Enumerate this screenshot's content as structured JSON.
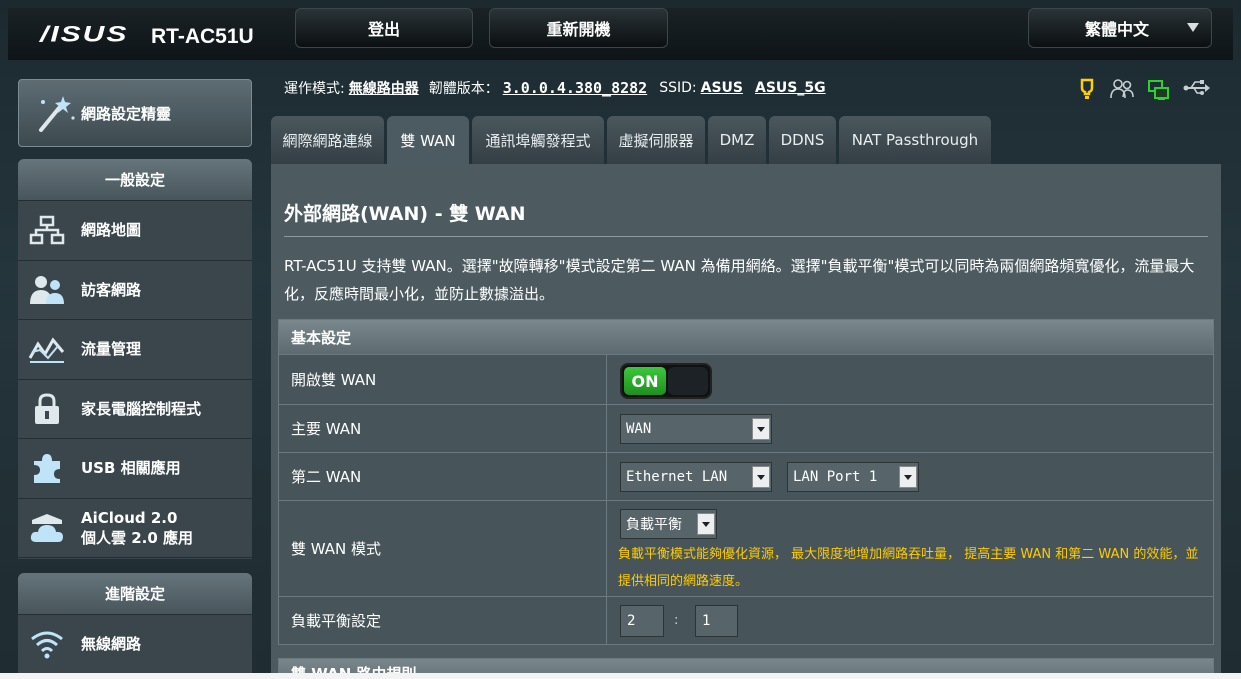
{
  "header": {
    "brand": "/ISUS",
    "model": "RT-AC51U",
    "logout_label": "登出",
    "reboot_label": "重新開機",
    "language": "繁體中文"
  },
  "sidebar": {
    "wizard_label": "網路設定精靈",
    "general_title": "一般設定",
    "general_items": [
      {
        "label": "網路地圖",
        "icon": "network-map-icon"
      },
      {
        "label": "訪客網路",
        "icon": "guest-network-icon"
      },
      {
        "label": "流量管理",
        "icon": "traffic-manager-icon"
      },
      {
        "label": "家長電腦控制程式",
        "icon": "lock-icon"
      },
      {
        "label": "USB 相關應用",
        "icon": "puzzle-icon"
      },
      {
        "label": "AiCloud 2.0",
        "label2": "個人雲 2.0 應用",
        "icon": "cloud-icon"
      }
    ],
    "advanced_title": "進階設定",
    "advanced_items": [
      {
        "label": "無線網路",
        "icon": "wifi-icon"
      }
    ]
  },
  "status": {
    "mode_label": "運作模式:",
    "mode_value": "無線路由器",
    "firmware_label": "韌體版本：",
    "firmware_value": "3.0.0.4.380_8282",
    "ssid_label": "SSID:",
    "ssid_1": "ASUS",
    "ssid_2": "ASUS_5G",
    "icons": [
      "notification-bulb-icon",
      "clients-icon",
      "network-status-icon",
      "usb-icon"
    ],
    "colors": {
      "bulb": "#ffd000",
      "network": "#2bd42b"
    }
  },
  "tabs": [
    {
      "label": "網際網路連線",
      "active": false
    },
    {
      "label": "雙 WAN",
      "active": true
    },
    {
      "label": "通訊埠觸發程式",
      "active": false
    },
    {
      "label": "虛擬伺服器",
      "active": false
    },
    {
      "label": "DMZ",
      "active": false
    },
    {
      "label": "DDNS",
      "active": false
    },
    {
      "label": "NAT Passthrough",
      "active": false
    }
  ],
  "main": {
    "title": "外部網路(WAN) - 雙 WAN",
    "description": "RT-AC51U 支持雙 WAN。選擇\"故障轉移\"模式設定第二 WAN 為備用網絡。選擇\"負載平衡\"模式可以同時為兩個網路頻寬優化，流量最大化，反應時間最小化，並防止數據溢出。",
    "section_title": "基本設定",
    "rows": {
      "enable_label": "開啟雙 WAN",
      "enable_state": "ON",
      "primary_label": "主要 WAN",
      "primary_value": "WAN",
      "second_label": "第二 WAN",
      "second_value": "Ethernet LAN",
      "second_port": "LAN Port 1",
      "mode_label": "雙 WAN 模式",
      "mode_value": "負載平衡",
      "mode_note": "負載平衡模式能夠優化資源， 最大限度地增加網路吞吐量， 提高主要 WAN 和第二 WAN 的效能，並提供相同的網路速度。",
      "lb_label": "負載平衡設定",
      "lb_ratio_1": "2",
      "lb_colon": ":",
      "lb_ratio_2": "1"
    },
    "next_section_title": "雙 WAN 路由規則"
  }
}
